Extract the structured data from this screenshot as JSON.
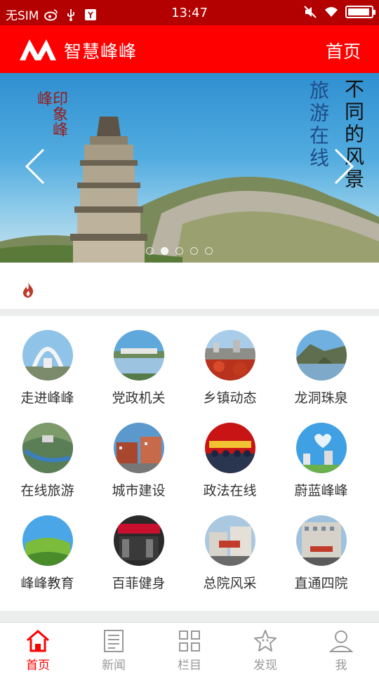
{
  "status_bar": {
    "carrier": "无SIM",
    "time": "13:47",
    "battery_level": 0.95,
    "icons": [
      "weibo-icon",
      "usb-icon",
      "debug-icon",
      "mute-icon",
      "wifi-icon",
      "battery-icon"
    ]
  },
  "header": {
    "app_title": "智慧峰峰",
    "home_link": "首页",
    "logo_icon": "mountain-logo-icon"
  },
  "banner": {
    "stamp_text": "印象峰峰",
    "calligraphy_col1": "旅游在线",
    "calligraphy_col2": "不同的风景",
    "slide_count": 5,
    "active_slide": 1,
    "prev_icon": "chevron-left-icon",
    "next_icon": "chevron-right-icon"
  },
  "notice": {
    "icon": "flame-icon",
    "text": ""
  },
  "grid": {
    "items": [
      {
        "label": "走进峰峰"
      },
      {
        "label": "党政机关"
      },
      {
        "label": "乡镇动态"
      },
      {
        "label": "龙洞珠泉"
      },
      {
        "label": "在线旅游"
      },
      {
        "label": "城市建设"
      },
      {
        "label": "政法在线"
      },
      {
        "label": "蔚蓝峰峰"
      },
      {
        "label": "峰峰教育"
      },
      {
        "label": "百菲健身"
      },
      {
        "label": "总院风采"
      },
      {
        "label": "直通四院"
      }
    ]
  },
  "tab_bar": {
    "tabs": [
      {
        "label": "首页",
        "icon": "home-icon",
        "active": true
      },
      {
        "label": "新闻",
        "icon": "news-icon",
        "active": false
      },
      {
        "label": "栏目",
        "icon": "grid-icon",
        "active": false
      },
      {
        "label": "发现",
        "icon": "star-icon",
        "active": false
      },
      {
        "label": "我",
        "icon": "user-icon",
        "active": false
      }
    ]
  },
  "colors": {
    "status_bar": "#b30000",
    "brand_red": "#ff0000",
    "tab_inactive": "#999999",
    "text": "#333333"
  }
}
